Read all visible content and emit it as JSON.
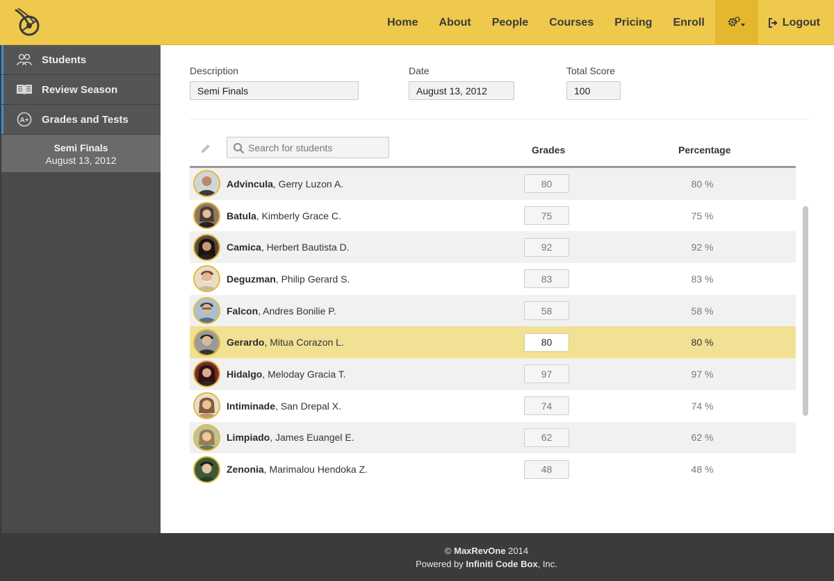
{
  "nav": {
    "items": [
      "Home",
      "About",
      "People",
      "Courses",
      "Pricing",
      "Enroll"
    ],
    "logout": "Logout"
  },
  "sidebar": {
    "items": [
      {
        "label": "Students",
        "icon": "users-icon"
      },
      {
        "label": "Review Season",
        "icon": "book-icon"
      },
      {
        "label": "Grades and Tests",
        "icon": "a-plus-icon"
      }
    ],
    "sub": {
      "title": "Semi Finals",
      "date": "August 13, 2012"
    }
  },
  "form": {
    "description_label": "Description",
    "description_value": "Semi Finals",
    "date_label": "Date",
    "date_value": "August 13, 2012",
    "total_label": "Total Score",
    "total_value": "100"
  },
  "table": {
    "search_placeholder": "Search for students",
    "grades_header": "Grades",
    "percentage_header": "Percentage",
    "rows": [
      {
        "last": "Advincula",
        "first": ", Gerry Luzon A.",
        "grade": "80",
        "pct": "80 %"
      },
      {
        "last": "Batula",
        "first": ", Kimberly Grace C.",
        "grade": "75",
        "pct": "75 %"
      },
      {
        "last": "Camica",
        "first": ", Herbert Bautista D.",
        "grade": "92",
        "pct": "92 %"
      },
      {
        "last": "Deguzman",
        "first": ", Philip Gerard S.",
        "grade": "83",
        "pct": "83 %"
      },
      {
        "last": "Falcon",
        "first": ", Andres Bonilie P.",
        "grade": "58",
        "pct": "58 %"
      },
      {
        "last": "Gerardo",
        "first": ", Mitua Corazon L.",
        "grade": "80",
        "pct": "80 %"
      },
      {
        "last": "Hidalgo",
        "first": ", Meloday Gracia T.",
        "grade": "97",
        "pct": "97 %"
      },
      {
        "last": "Intiminade",
        "first": ", San Drepal X.",
        "grade": "74",
        "pct": "74 %"
      },
      {
        "last": "Limpiado",
        "first": ", James Euangel E.",
        "grade": "62",
        "pct": "62 %"
      },
      {
        "last": "Zenonia",
        "first": ", Marimalou Hendoka Z.",
        "grade": "48",
        "pct": "48 %"
      }
    ]
  },
  "footer": {
    "copyright": "©",
    "brand": "MaxRevOne",
    "year": "2014",
    "powered": "Powered by",
    "company": "Infiniti Code Box",
    "suffix": ", Inc."
  },
  "colors": {
    "accent": "#efc94c",
    "sidebar": "#4a4a4a",
    "highlight": "#f1e194"
  }
}
